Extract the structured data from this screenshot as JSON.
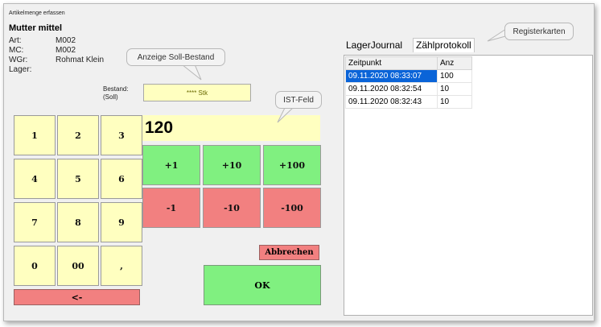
{
  "window": {
    "title": "Artikelmenge erfassen"
  },
  "article": {
    "name": "Mutter mittel",
    "fields": [
      {
        "key": "Art:",
        "value": "M002"
      },
      {
        "key": "MC:",
        "value": "M002"
      },
      {
        "key": "WGr:",
        "value": "Rohmat Klein"
      },
      {
        "key": "Lager:",
        "value": ""
      }
    ]
  },
  "bestand": {
    "label_line1": "Bestand:",
    "label_line2": "(Soll)",
    "value": "**** Stk"
  },
  "ist": {
    "value": "120"
  },
  "keypad": {
    "k1": "1",
    "k2": "2",
    "k3": "3",
    "k4": "4",
    "k5": "5",
    "k6": "6",
    "k7": "7",
    "k8": "8",
    "k9": "9",
    "k0": "0",
    "k00": "00",
    "comma": ",",
    "backspace": "<-"
  },
  "increments": {
    "p1": "+1",
    "p10": "+10",
    "p100": "+100",
    "m1": "-1",
    "m10": "-10",
    "m100": "-100"
  },
  "actions": {
    "cancel": "Abbrechen",
    "ok": "OK"
  },
  "tabs": {
    "journal": "LagerJournal",
    "protocol": "Zählprotokoll"
  },
  "protocol_table": {
    "headers": {
      "time": "Zeitpunkt",
      "qty": "Anz"
    },
    "rows": [
      {
        "time": "09.11.2020 08:33:07",
        "qty": "100"
      },
      {
        "time": "09.11.2020 08:32:54",
        "qty": "10"
      },
      {
        "time": "09.11.2020 08:32:43",
        "qty": "10"
      }
    ]
  },
  "callouts": {
    "soll": "Anzeige Soll-Bestand",
    "ist": "IST-Feld",
    "register": "Registerkarten"
  },
  "colors": {
    "yellow": "#ffffc0",
    "green": "#80f080",
    "red": "#f28080",
    "selection": "#0a64d8"
  }
}
